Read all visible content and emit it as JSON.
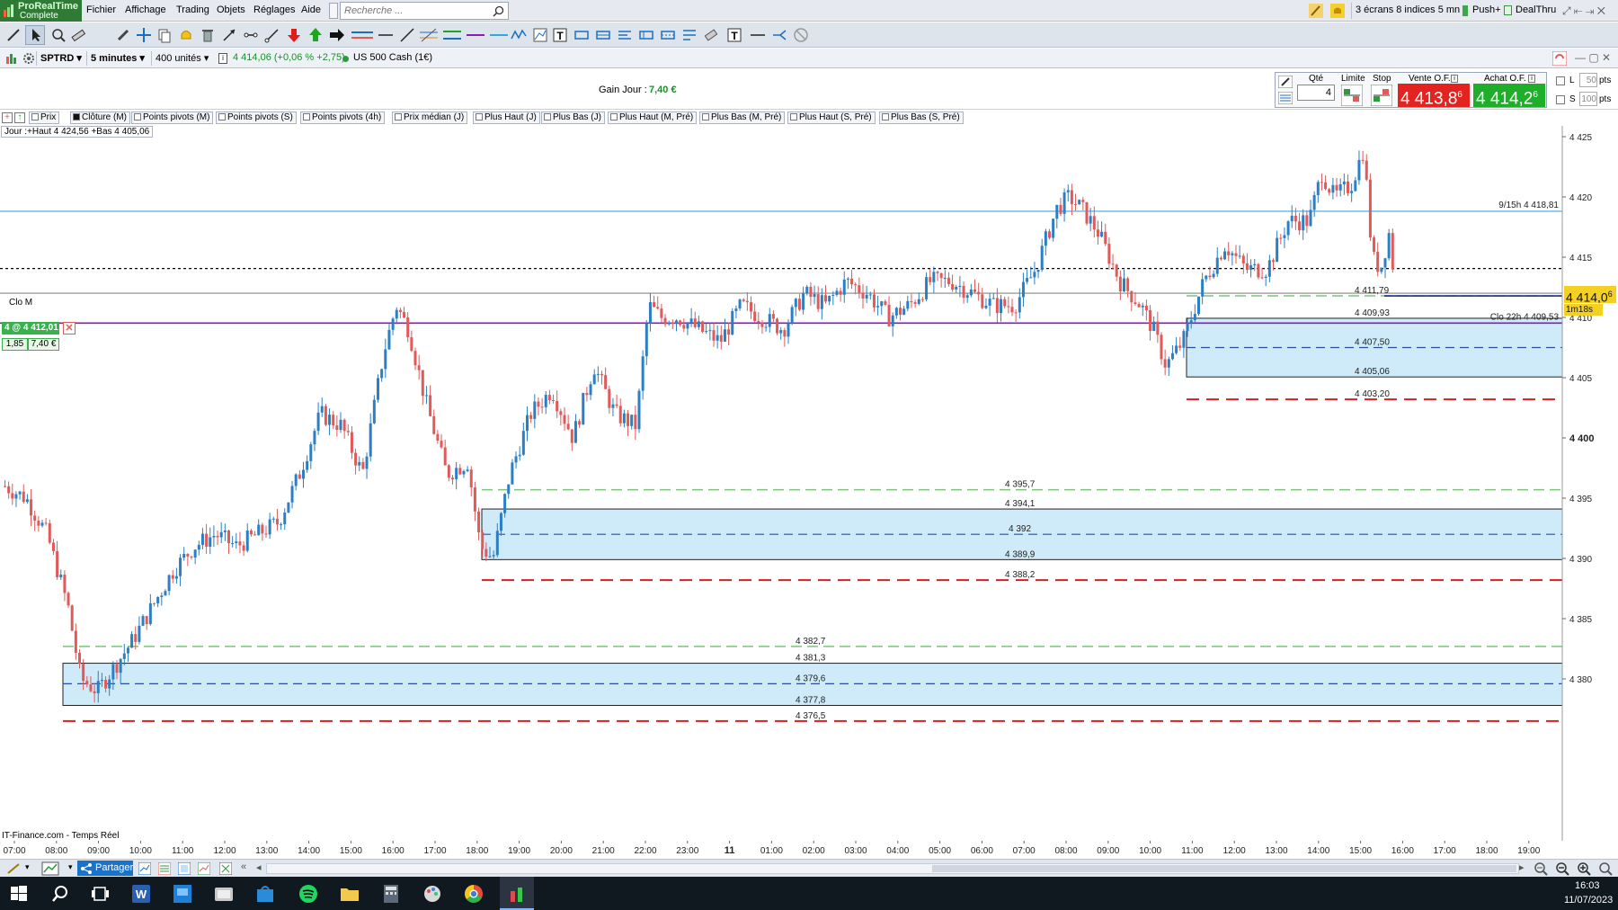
{
  "app": {
    "logo_line1": "ProRealTime",
    "logo_line2": "Complete",
    "menu": [
      "Fichier",
      "Affichage",
      "Trading",
      "Objets",
      "Réglages",
      "Aide"
    ],
    "search_placeholder": "Recherche ...",
    "right": {
      "workspace": "3 écrans 8 indices 5 mn",
      "push": "Push+",
      "dealthru": "DealThru"
    }
  },
  "infobar": {
    "symbol": "SPTRD",
    "timeframe": "5 minutes",
    "units": "400 unités",
    "quote": "4 414,06 (+0,06 % +2,75)",
    "instrument": "US 500 Cash (1€)"
  },
  "order": {
    "gain_label": "Gain Jour :",
    "gain_value": "7,40 €",
    "qty_label": "Qté",
    "qty_value": "4",
    "limit_label": "Limite",
    "stop_label": "Stop",
    "sell_label": "Vente O.F.",
    "buy_label": "Achat O.F.",
    "sell_price": "4 413,8",
    "sell_sup": "6",
    "buy_price": "4 414,2",
    "buy_sup": "6",
    "l_label": "L",
    "s_label": "S",
    "l_value": "50",
    "s_value": "100",
    "pts": "pts"
  },
  "indicators": [
    "Prix",
    "Clôture (M)",
    "Points pivots (M)",
    "Points pivots (S)",
    "Points pivots (4h)",
    "Prix médian (J)",
    "Plus Haut (J)",
    "Plus Bas (J)",
    "Plus Haut (M, Pré)",
    "Plus Bas (M, Pré)",
    "Plus Haut (S, Pré)",
    "Plus Bas (S, Pré)"
  ],
  "day_info": "Jour :+Haut 4 424,56 +Bas 4 405,06",
  "position": {
    "label": "4 @ 4 412,01",
    "qty": "1,85",
    "pnl": "7,40 €"
  },
  "clo_m": "Clo M",
  "source": "IT-Finance.com - Temps Réel",
  "chart_data": {
    "type": "candlestick",
    "ylim": [
      4374.5,
      4427.5
    ],
    "y_ticks": [
      "4 425",
      "4 420",
      "4 415",
      "4 410",
      "4 405",
      "4 400",
      "4 395",
      "4 390",
      "4 385",
      "4 380"
    ],
    "y_tick_values": [
      4425,
      4420,
      4415,
      4410,
      4405,
      4400,
      4395,
      4390,
      4385,
      4380
    ],
    "x_ticks": [
      "07:00",
      "08:00",
      "09:00",
      "10:00",
      "11:00",
      "12:00",
      "13:00",
      "14:00",
      "15:00",
      "16:00",
      "17:00",
      "18:00",
      "19:00",
      "20:00",
      "21:00",
      "22:00",
      "23:00",
      "11",
      "01:00",
      "02:00",
      "03:00",
      "04:00",
      "05:00",
      "06:00",
      "07:00",
      "08:00",
      "09:00",
      "10:00",
      "11:00",
      "12:00",
      "13:00",
      "14:00",
      "15:00",
      "16:00",
      "17:00",
      "18:00",
      "19:00"
    ],
    "current_price": "4 414,0",
    "current_sup": "6",
    "timer": "1m18s",
    "hlines": [
      {
        "value": 4418.81,
        "label": "9/15h 4 418,81",
        "color": "#4aa3df",
        "style": "solid"
      },
      {
        "value": 4414.06,
        "label": "",
        "color": "#000000",
        "style": "dotted"
      },
      {
        "value": 4412.01,
        "label": "",
        "color": "#888888",
        "style": "solid"
      },
      {
        "value": 4409.53,
        "label": "Clo 22h 4 409,53",
        "color": "#8a1bb5",
        "style": "solid"
      },
      {
        "value": 4411.79,
        "label": "",
        "color": "#1a2a8a",
        "style": "solid"
      }
    ],
    "zones": [
      {
        "top": 4409.93,
        "bottom": 4405.06,
        "mid": 4407.5,
        "above": 4411.79,
        "below": 4403.2,
        "labels": [
          "4 411,79",
          "4 409,93",
          "4 407,50",
          "4 405,06",
          "4 403,20"
        ]
      },
      {
        "top": 4394.1,
        "bottom": 4389.9,
        "mid": 4392,
        "above": 4395.7,
        "below": 4388.2,
        "labels": [
          "4 395,7",
          "4 394,1",
          "4 392",
          "4 389,9",
          "4 388,2"
        ]
      },
      {
        "top": 4381.3,
        "bottom": 4377.8,
        "mid": 4379.6,
        "above": 4382.7,
        "below": 4376.5,
        "labels": [
          "4 382,7",
          "4 381,3",
          "4 379,6",
          "4 377,8",
          "4 376,5"
        ]
      }
    ],
    "close_path": [
      [
        0,
        4396
      ],
      [
        0.5,
        4395
      ],
      [
        1,
        4392
      ],
      [
        1.5,
        4386
      ],
      [
        1.8,
        4380
      ],
      [
        2.2,
        4379
      ],
      [
        2.6,
        4381
      ],
      [
        3.0,
        4383
      ],
      [
        3.5,
        4386
      ],
      [
        4.0,
        4389
      ],
      [
        4.5,
        4391
      ],
      [
        5,
        4392
      ],
      [
        5.5,
        4391
      ],
      [
        6,
        4392
      ],
      [
        6.5,
        4393
      ],
      [
        7.0,
        4397
      ],
      [
        7.5,
        4402
      ],
      [
        8.0,
        4401
      ],
      [
        8.5,
        4397
      ],
      [
        9.0,
        4407
      ],
      [
        9.3,
        4411
      ],
      [
        9.6,
        4409
      ],
      [
        10,
        4403
      ],
      [
        10.5,
        4397
      ],
      [
        11,
        4398
      ],
      [
        11.3,
        4391
      ],
      [
        11.6,
        4390
      ],
      [
        12,
        4397
      ],
      [
        12.5,
        4402
      ],
      [
        13,
        4404
      ],
      [
        13.5,
        4400
      ],
      [
        14,
        4406
      ],
      [
        14.5,
        4402
      ],
      [
        15,
        4401
      ],
      [
        15.3,
        4411
      ],
      [
        15.6,
        4410
      ],
      [
        16,
        4410
      ],
      [
        16.5,
        4409
      ],
      [
        17,
        4408
      ],
      [
        17.5,
        4411
      ],
      [
        18,
        4410
      ],
      [
        18.5,
        4409
      ],
      [
        19,
        4412
      ],
      [
        19.5,
        4411
      ],
      [
        20,
        4413
      ],
      [
        20.5,
        4412
      ],
      [
        21,
        4410
      ],
      [
        21.5,
        4411
      ],
      [
        22,
        4413
      ],
      [
        22.5,
        4413
      ],
      [
        23,
        4412
      ],
      [
        23.5,
        4411
      ],
      [
        24,
        4411
      ],
      [
        24.5,
        4414
      ],
      [
        25,
        4419
      ],
      [
        25.3,
        4420
      ],
      [
        25.6,
        4419
      ],
      [
        26,
        4417
      ],
      [
        26.5,
        4413
      ],
      [
        27,
        4411
      ],
      [
        27.3,
        4409
      ],
      [
        27.6,
        4406
      ],
      [
        28,
        4408
      ],
      [
        28.5,
        4413
      ],
      [
        29,
        4416
      ],
      [
        29.5,
        4414
      ],
      [
        30,
        4414
      ],
      [
        30.5,
        4418
      ],
      [
        31,
        4418
      ],
      [
        31.3,
        4422
      ],
      [
        31.6,
        4420
      ],
      [
        32,
        4421
      ],
      [
        32.3,
        4424
      ],
      [
        32.5,
        4415
      ],
      [
        32.7,
        4414
      ],
      [
        32.9,
        4417
      ],
      [
        33.0,
        4414
      ]
    ]
  },
  "taskbar": {
    "time": "16:03",
    "date": "11/07/2023"
  },
  "bottom": {
    "partager": "Partager"
  },
  "colors": {
    "up": "#2b7fc4",
    "down": "#e05a5a",
    "zone": "#cfeaf8"
  }
}
